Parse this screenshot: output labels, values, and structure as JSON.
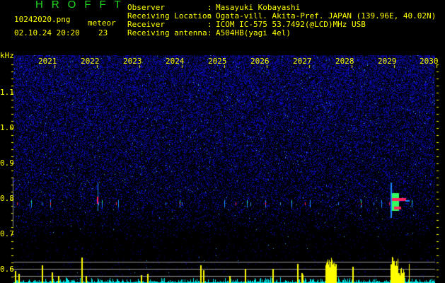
{
  "header": {
    "app_title": "HROFFT",
    "filename": "10242020.png",
    "datetime": "02.10.24 20:20",
    "meteor_label": "meteor",
    "meteor_count": "23"
  },
  "station": {
    "observer_label": "Observer",
    "observer": "Masayuki Kobayashi",
    "location_label": "Receiving Location",
    "location": "Ogata-vill. Akita-Pref. JAPAN (139.96E, 40.02N)",
    "receiver_label": "Receiver",
    "receiver": "ICOM IC-575 53.7492(@LCD)MHz USB",
    "antenna_label": "Receiving antenna",
    "antenna": "A504HB(yagi 4el)",
    "separator": ":"
  },
  "axis": {
    "y_unit": "kHz",
    "y_labels": [
      "1.1",
      "1.0",
      "0.9",
      "0.8",
      "0.7",
      "0.6"
    ],
    "x_labels": [
      "2021",
      "2022",
      "2023",
      "2024",
      "2025",
      "2026",
      "2027",
      "2028",
      "2029",
      "2030"
    ]
  },
  "colors": {
    "text": "#ffff00",
    "title": "#22dd22",
    "noise": "#1010c0",
    "echo": "#ff2060",
    "bar": "#ffff00",
    "bar_low": "#00e5e5"
  }
}
